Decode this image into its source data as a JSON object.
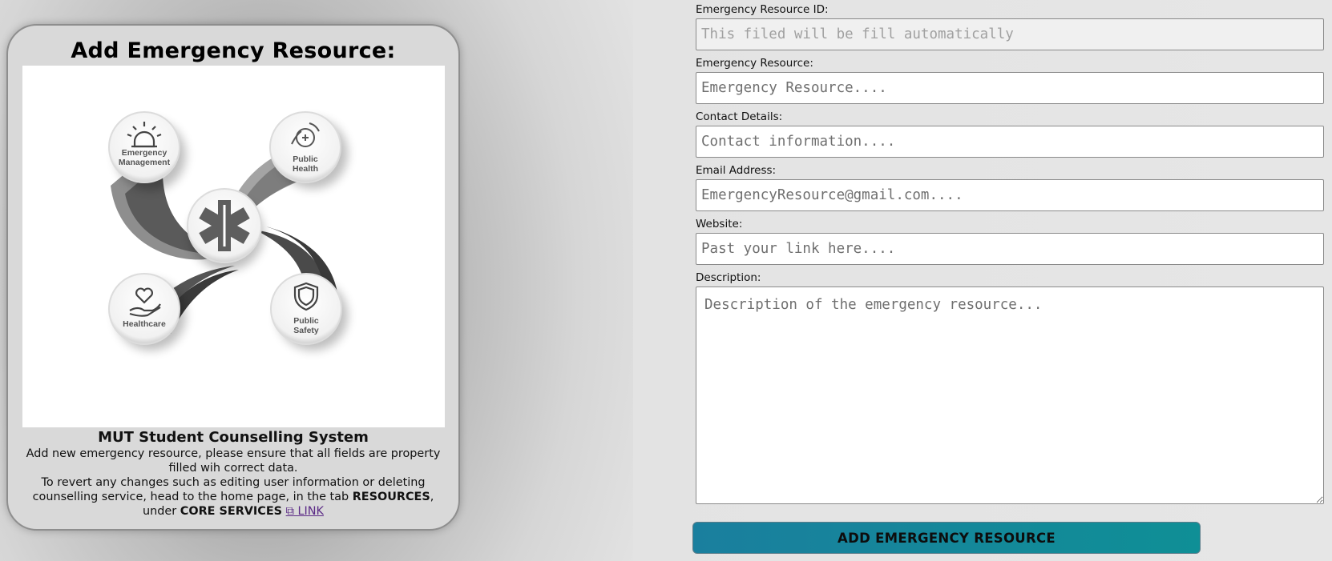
{
  "card": {
    "title": "Add Emergency Resource:",
    "illustration": {
      "center_icon": "star-of-life-icon",
      "nodes": [
        {
          "line1": "Emergency",
          "line2": "Management",
          "icon": "siren-icon"
        },
        {
          "line1": "Public",
          "line2": "Health",
          "icon": "hands-heart-icon"
        },
        {
          "line1": "",
          "line2": "Healthcare",
          "icon": "hand-heart-icon"
        },
        {
          "line1": "Public",
          "line2": "Safety",
          "icon": "shield-icon"
        }
      ]
    },
    "system_title": "MUT Student Counselling System",
    "description_1": "Add new emergency resource, please ensure that all fields are property filled wih correct data.",
    "description_2_prefix": "To revert any changes such as editing user information or deleting counselling service, head to the home page, in the tab",
    "resources_bold": "RESOURCES",
    "under_text": ", under",
    "core_services_bold": "CORE SERVICES",
    "link_icon": "⧉",
    "link_label": "LINK"
  },
  "form": {
    "id_label": "Emergency Resource ID:",
    "id_placeholder": "This filed will be fill automatically",
    "resource_label": "Emergency Resource:",
    "resource_placeholder": "Emergency Resource....",
    "contact_label": "Contact Details:",
    "contact_placeholder": "Contact information....",
    "email_label": "Email Address:",
    "email_placeholder": "EmergencyResource@gmail.com....",
    "website_label": "Website:",
    "website_placeholder": "Past your link here....",
    "description_label": "Description:",
    "description_placeholder": "Description of the emergency resource...",
    "submit_label": "ADD EMERGENCY RESOURCE"
  },
  "colors": {
    "button_gradient_start": "#1a7f9e",
    "button_gradient_end": "#0f8f96",
    "link": "#5b2a86"
  }
}
